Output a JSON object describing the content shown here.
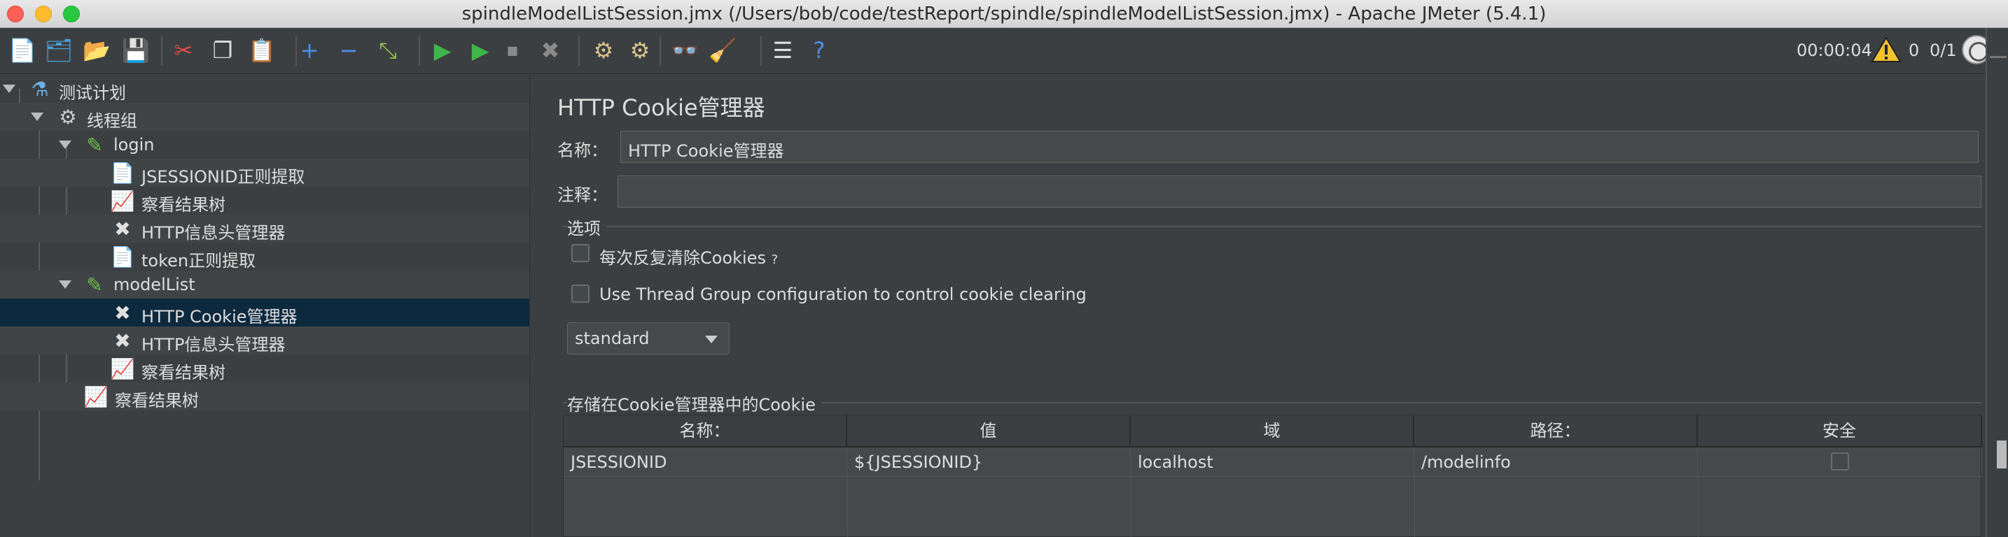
{
  "window": {
    "title": "spindleModelListSession.jmx (/Users/bob/code/testReport/spindle/spindleModelListSession.jmx) - Apache JMeter (5.4.1)"
  },
  "toolbar": {
    "buttons": [
      {
        "name": "new-icon",
        "glyph": "📄",
        "color": "#f2f2f2"
      },
      {
        "name": "templates-icon",
        "glyph": "🗂",
        "color": "#4a9fd8"
      },
      {
        "name": "open-icon",
        "glyph": "📂",
        "color": "#e8b23a"
      },
      {
        "name": "save-icon",
        "glyph": "💾",
        "color": "#dddddd"
      },
      {
        "name": "cut-icon",
        "glyph": "✂",
        "color": "#e04a4a"
      },
      {
        "name": "copy-icon",
        "glyph": "❐",
        "color": "#dddddd"
      },
      {
        "name": "paste-icon",
        "glyph": "📋",
        "color": "#e8c060"
      },
      {
        "name": "expand-icon",
        "glyph": "+",
        "color": "#4a8fe8"
      },
      {
        "name": "collapse-icon",
        "glyph": "−",
        "color": "#4a8fe8"
      },
      {
        "name": "toggle-icon",
        "glyph": "⤡",
        "color": "#8fc050"
      },
      {
        "name": "start-icon",
        "glyph": "▶",
        "color": "#3fb64a"
      },
      {
        "name": "start-no-pause-icon",
        "glyph": "▶",
        "color": "#3fb64a"
      },
      {
        "name": "stop-icon",
        "glyph": "⏹",
        "color": "#8a8a8a"
      },
      {
        "name": "shutdown-icon",
        "glyph": "✖",
        "color": "#8a8a8a"
      },
      {
        "name": "clear-icon",
        "glyph": "⚙",
        "color": "#d8c28a"
      },
      {
        "name": "clear-all-icon",
        "glyph": "⚙",
        "color": "#d8c28a"
      },
      {
        "name": "search-icon",
        "glyph": "👓",
        "color": "#cccccc"
      },
      {
        "name": "reset-search-icon",
        "glyph": "🧹",
        "color": "#f2c230"
      },
      {
        "name": "function-helper-icon",
        "glyph": "☰",
        "color": "#dddddd"
      },
      {
        "name": "help-icon",
        "glyph": "?",
        "color": "#4a8fe8"
      }
    ],
    "timer": "00:00:04",
    "error_count": "0",
    "threads": "0/1"
  },
  "tree": {
    "items": [
      {
        "label": "测试计划",
        "name": "tree-item-test-plan",
        "icon": "flask-icon",
        "glyph": "⚗",
        "expanded": true
      },
      {
        "label": "线程组",
        "name": "tree-item-thread-group",
        "icon": "gear-icon",
        "glyph": "⚙",
        "expanded": true
      },
      {
        "label": "login",
        "name": "tree-item-login",
        "icon": "sampler-pipette-icon",
        "glyph": "✎",
        "expanded": true
      },
      {
        "label": "JSESSIONID正则提取",
        "name": "tree-item-jsessionid-extractor",
        "icon": "extractor-icon",
        "glyph": "📄"
      },
      {
        "label": "察看结果树",
        "name": "tree-item-results-tree-1",
        "icon": "listener-icon",
        "glyph": "📈"
      },
      {
        "label": "HTTP信息头管理器",
        "name": "tree-item-header-manager-1",
        "icon": "wrench-icon",
        "glyph": "✖"
      },
      {
        "label": "token正则提取",
        "name": "tree-item-token-extractor",
        "icon": "extractor-icon",
        "glyph": "📄"
      },
      {
        "label": "modelList",
        "name": "tree-item-modellist",
        "icon": "sampler-pipette-icon",
        "glyph": "✎",
        "expanded": true
      },
      {
        "label": "HTTP Cookie管理器",
        "name": "tree-item-cookie-manager",
        "icon": "wrench-icon",
        "glyph": "✖",
        "selected": true
      },
      {
        "label": "HTTP信息头管理器",
        "name": "tree-item-header-manager-2",
        "icon": "wrench-icon",
        "glyph": "✖"
      },
      {
        "label": "察看结果树",
        "name": "tree-item-results-tree-2",
        "icon": "listener-icon",
        "glyph": "📈"
      },
      {
        "label": "察看结果树",
        "name": "tree-item-results-tree-3",
        "icon": "listener-icon",
        "glyph": "📈"
      }
    ]
  },
  "panel": {
    "title": "HTTP Cookie管理器",
    "name_label": "名称：",
    "name_value": "HTTP Cookie管理器",
    "comment_label": "注释：",
    "comment_value": "",
    "options_title": "选项",
    "clear_each_iteration_label": "每次反复清除Cookies",
    "clear_each_iteration_suffix": "?",
    "thread_group_config_label": "Use Thread Group configuration to control cookie clearing",
    "policy_value": "standard",
    "stored_cookies_title": "存储在Cookie管理器中的Cookie"
  },
  "cookie_table": {
    "columns": [
      "名称：",
      "值",
      "域",
      "路径：",
      "安全"
    ],
    "rows": [
      {
        "name": "JSESSIONID",
        "value": "${JSESSIONID}",
        "domain": "localhost",
        "path": "/modelinfo",
        "secure": false
      }
    ]
  },
  "colors": {
    "background": "#3c3f41",
    "selection": "#0d293e",
    "text": "#dddddd"
  }
}
